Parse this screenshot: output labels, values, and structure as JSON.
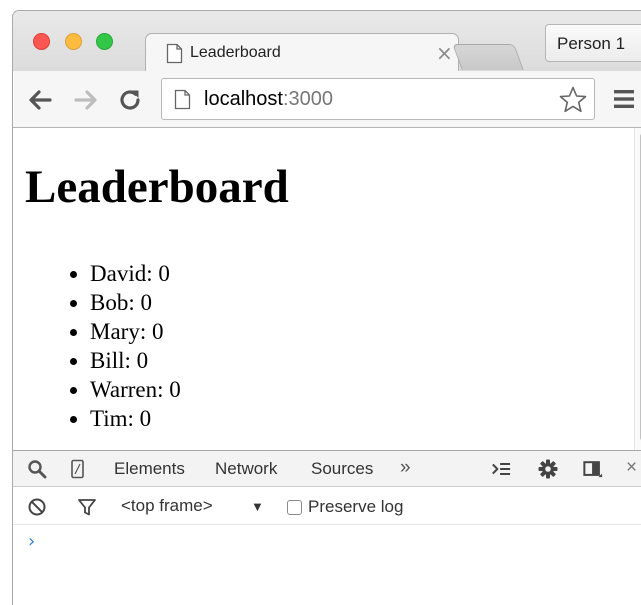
{
  "browser": {
    "tab_title": "Leaderboard",
    "tab_close_glyph": "×",
    "profile_name": "Person 1",
    "url_host": "localhost",
    "url_port": ":3000"
  },
  "page": {
    "title": "Leaderboard",
    "players": [
      {
        "name": "David",
        "score": 0,
        "text": "David: 0"
      },
      {
        "name": "Bob",
        "score": 0,
        "text": "Bob: 0"
      },
      {
        "name": "Mary",
        "score": 0,
        "text": "Mary: 0"
      },
      {
        "name": "Bill",
        "score": 0,
        "text": "Bill: 0"
      },
      {
        "name": "Warren",
        "score": 0,
        "text": "Warren: 0"
      },
      {
        "name": "Tim",
        "score": 0,
        "text": "Tim: 0"
      }
    ]
  },
  "devtools": {
    "tabs": [
      "Elements",
      "Network",
      "Sources"
    ],
    "more_glyph": "»",
    "close_glyph": "×",
    "frame_selector": "<top frame>",
    "frame_arrow": "▼",
    "preserve_log_label": "Preserve log",
    "preserve_log_checked": false,
    "prompt_glyph": "›"
  },
  "colors": {
    "close": "#fc5753",
    "minimize": "#fdbc40",
    "maximize": "#33c748",
    "console_prompt": "#2d7de0"
  },
  "icons": [
    "page-icon",
    "back-arrow-icon",
    "forward-arrow-icon",
    "reload-icon",
    "star-icon",
    "menu-icon",
    "search-icon",
    "device-icon",
    "console-drawer-icon",
    "gear-icon",
    "dock-icon",
    "clear-icon",
    "filter-icon"
  ]
}
